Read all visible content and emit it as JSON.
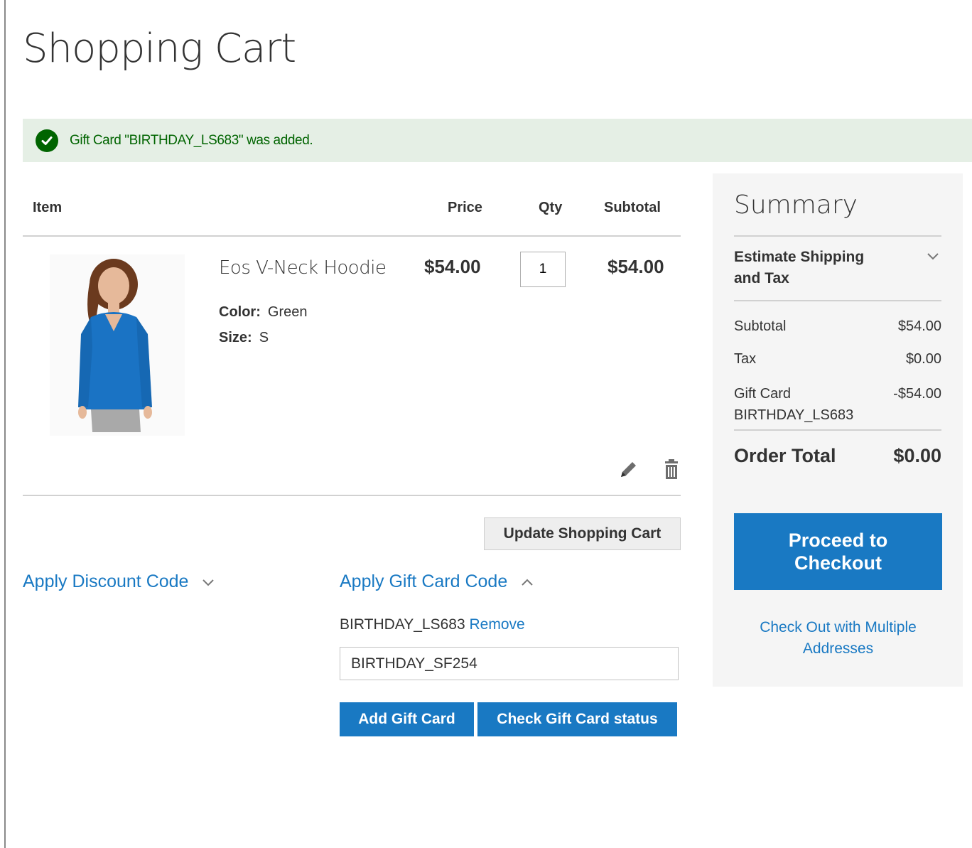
{
  "page": {
    "title": "Shopping Cart"
  },
  "message": {
    "text": "Gift Card \"BIRTHDAY_LS683\" was added."
  },
  "table": {
    "headers": {
      "item": "Item",
      "price": "Price",
      "qty": "Qty",
      "subtotal": "Subtotal"
    }
  },
  "item": {
    "name": "Eos V-Neck Hoodie",
    "price": "$54.00",
    "qty": "1",
    "subtotal": "$54.00",
    "options": [
      {
        "label": "Color:",
        "value": "Green"
      },
      {
        "label": "Size:",
        "value": "S"
      }
    ]
  },
  "actions": {
    "update_cart": "Update Shopping Cart"
  },
  "discount": {
    "label": "Apply Discount Code"
  },
  "giftcard": {
    "label": "Apply Gift Card Code",
    "applied_code": "BIRTHDAY_LS683",
    "remove_label": "Remove",
    "input_value": "BIRTHDAY_SF254",
    "add_button": "Add Gift Card",
    "check_button": "Check Gift Card status"
  },
  "summary": {
    "title": "Summary",
    "estimate_label": "Estimate Shipping and Tax",
    "subtotal_label": "Subtotal",
    "subtotal_value": "$54.00",
    "tax_label": "Tax",
    "tax_value": "$0.00",
    "giftcard_label": "Gift Card",
    "giftcard_code": "BIRTHDAY_LS683",
    "giftcard_value": "-$54.00",
    "order_total_label": "Order Total",
    "order_total_value": "$0.00",
    "checkout_button": "Proceed to Checkout",
    "multi_address_link": "Check Out with Multiple Addresses"
  },
  "colors": {
    "accent": "#1979c3",
    "success": "#006400",
    "success_bg": "#e5efe5",
    "product": "#1a73c4"
  }
}
